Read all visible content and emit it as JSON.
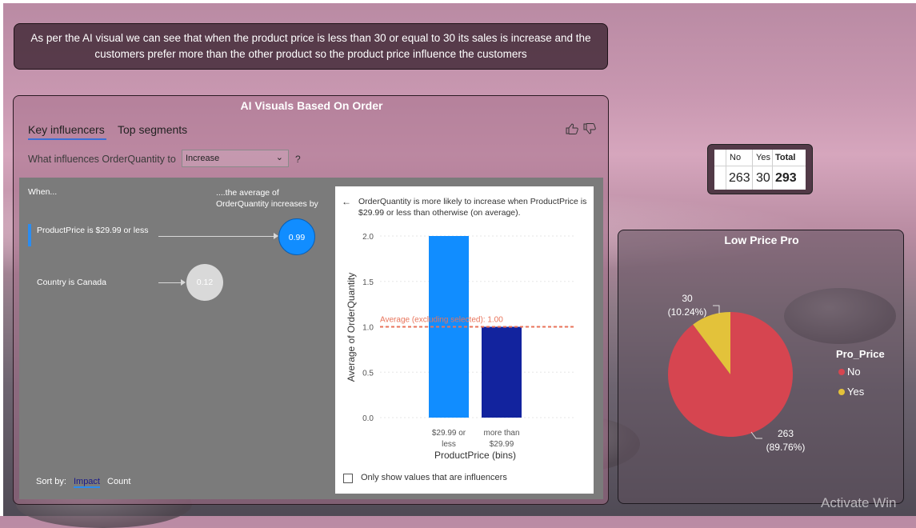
{
  "note": {
    "text": "As per the AI visual we can see that when the product price is less than 30 or equal to 30 its sales is increase and the customers prefer more than the other product so the product price influence the customers"
  },
  "ai_visual": {
    "title": "AI Visuals Based On Order",
    "tabs": [
      {
        "label": "Key influencers",
        "selected": true
      },
      {
        "label": "Top segments",
        "selected": false
      }
    ],
    "question_label": "What influences OrderQuantity to",
    "question_value": "Increase",
    "question_mark": "?",
    "when_header": "When...",
    "avg_header": "....the average of OrderQuantity increases by",
    "influencers": [
      {
        "label": "ProductPrice is $29.99 or less",
        "value": "0.99",
        "selected": true
      },
      {
        "label": "Country is Canada",
        "value": "0.12",
        "selected": false
      }
    ],
    "sort_label": "Sort by:",
    "sort_options": [
      "Impact",
      "Count"
    ],
    "detail": {
      "back_icon": "arrow-left-icon",
      "heading": "OrderQuantity is more likely to increase when ProductPrice is $29.99 or less than otherwise (on average).",
      "checkbox_label": "Only show values that are influencers",
      "checkbox_checked": false
    }
  },
  "chart_data": {
    "type": "bar",
    "categories": [
      "$29.99 or less",
      "more than $29.99"
    ],
    "values": [
      2.0,
      1.0
    ],
    "bar_colors": [
      "#118dff",
      "#12239e"
    ],
    "xlabel": "ProductPrice (bins)",
    "ylabel": "Average of OrderQuantity",
    "yticks": [
      "0.0",
      "0.5",
      "1.0",
      "1.5",
      "2.0"
    ],
    "ylim": [
      0,
      2.0
    ],
    "reference_line": {
      "label": "Average (excluding selected): 1.00",
      "value": 1.0,
      "color": "#e8735a"
    }
  },
  "matrix": {
    "headers": [
      "No",
      "Yes",
      "Total"
    ],
    "values": [
      "263",
      "30",
      "293"
    ]
  },
  "pie": {
    "title": "Low Price Pro",
    "legend_title": "Pro_Price",
    "slices": [
      {
        "name": "No",
        "value": 263,
        "label": "263",
        "pct": "(89.76%)",
        "color": "#d64550"
      },
      {
        "name": "Yes",
        "value": 30,
        "label": "30",
        "pct": "(10.24%)",
        "color": "#e3c23a"
      }
    ]
  },
  "watermark": "Activate Win"
}
